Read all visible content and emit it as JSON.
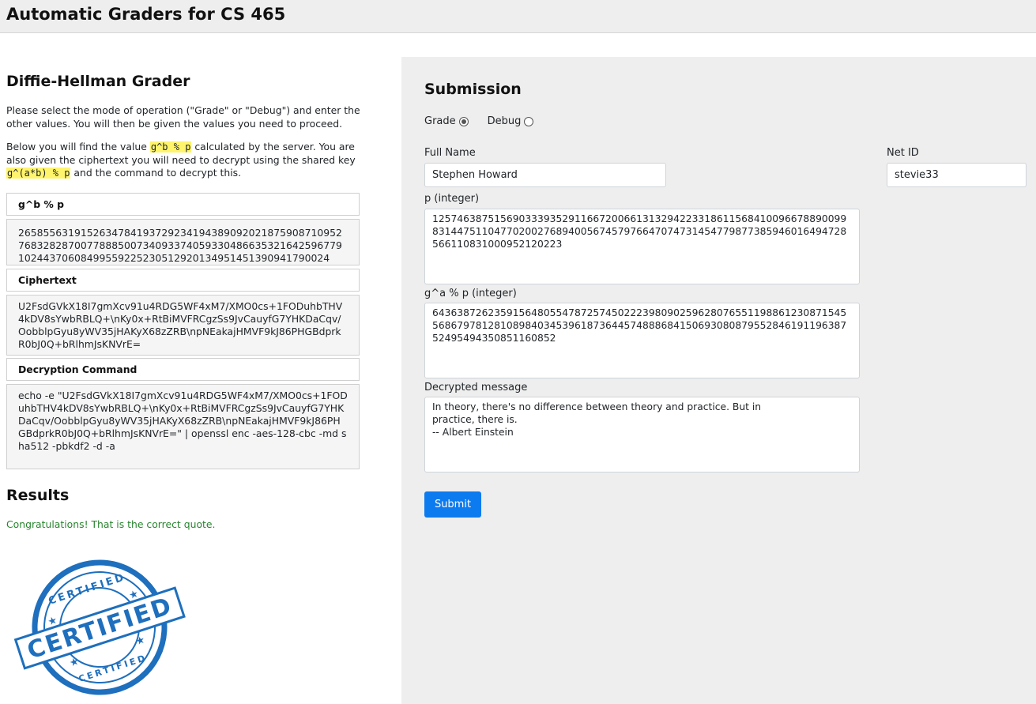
{
  "header": {
    "title": "Automatic Graders for CS 465"
  },
  "grader": {
    "title": "Diffie-Hellman Grader",
    "intro": "Please select the mode of operation (\"Grade\" or \"Debug\") and enter the other values. You will then be given the values you need to proceed.",
    "desc_1": "Below you will find the value ",
    "code_1": "g^b % p",
    "desc_2": " calculated by the server. You are also given the ciphertext you will need to decrypt using the shared key ",
    "code_2": "g^(a*b) % p",
    "desc_3": " and the command to decrypt this.",
    "gb_label": "g^b % p",
    "gb_value": "2658556319152634784193729234194389092021875908710952768328287007788850073409337405933048663532164259677910244370608499559225230512920134951451390941790024",
    "ciphertext_label": "Ciphertext",
    "ciphertext_value": "U2FsdGVkX18I7gmXcv91u4RDG5WF4xM7/XMO0cs+1FODuhbTHV4kDV8sYwbRBLQ+\\nKy0x+RtBiMVFRCgzSs9JvCauyfG7YHKDaCqv/OobblpGyu8yWV35jHAKyX68zZRB\\npNEakajHMVF9kJ86PHGBdprkR0bJ0Q+bRlhmJsKNVrE=",
    "command_label": "Decryption Command",
    "command_value": "echo -e \"U2FsdGVkX18I7gmXcv91u4RDG5WF4xM7/XMO0cs+1FODuhbTHV4kDV8sYwbRBLQ+\\nKy0x+RtBiMVFRCgzSs9JvCauyfG7YHKDaCqv/OobblpGyu8yWV35jHAKyX68zZRB\\npNEakajHMVF9kJ86PHGBdprkR0bJ0Q+bRlhmJsKNVrE=\" | openssl enc -aes-128-cbc -md sha512 -pbkdf2 -d -a"
  },
  "results": {
    "title": "Results",
    "message": "Congratulations! That is the correct quote.",
    "stamp_text_big": "CERTIFIED",
    "stamp_text_small": "CERTIFIED"
  },
  "submission": {
    "title": "Submission",
    "mode_grade_label": "Grade",
    "mode_debug_label": "Debug",
    "selected_mode": "Grade",
    "full_name_label": "Full Name",
    "full_name_value": "Stephen Howard",
    "net_id_label": "Net ID",
    "net_id_value": "stevie33",
    "p_label": "p (integer)",
    "p_value": "12574638751569033393529116672006613132942233186115684100966788900998314475110477020027689400567457976647074731454779877385946016494728566110831000952120223",
    "ga_label": "g^a % p (integer)",
    "ga_value": "6436387262359156480554787257450222398090259628076551198861230871545568679781281089840345396187364457488868415069308087955284619119638752495494350851160852",
    "message_label": "Decrypted message",
    "message_value": "In theory, there's no difference between theory and practice. But in\npractice, there is.\n-- Albert Einstein",
    "submit_label": "Submit"
  },
  "colors": {
    "accent": "#0d7bf0",
    "success": "#28852f",
    "highlight": "#fff46b",
    "stamp": "#1e6fbd"
  }
}
